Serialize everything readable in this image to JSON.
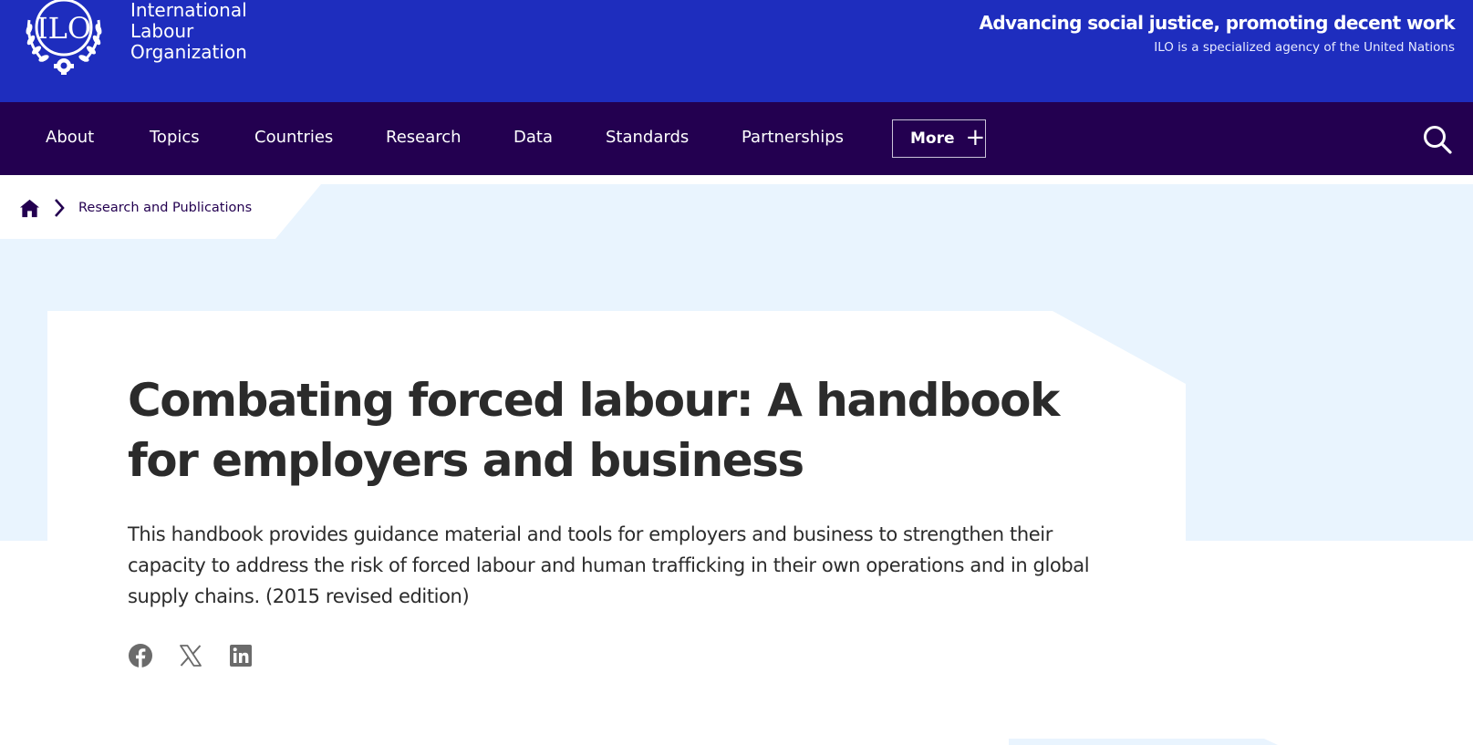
{
  "header": {
    "org_name_lines": [
      "International",
      "Labour",
      "Organization"
    ],
    "logo_text": "ILO",
    "tagline": "Advancing social justice, promoting decent work",
    "subtagline": "ILO is a specialized agency of the United Nations"
  },
  "nav": {
    "items": [
      "About",
      "Topics",
      "Countries",
      "Research",
      "Data",
      "Standards",
      "Partnerships"
    ],
    "more_label": "More",
    "more_icon": "plus-icon",
    "search_icon": "search-icon"
  },
  "breadcrumb": {
    "home_icon": "home-icon",
    "separator_icon": "chevron-right-icon",
    "current": "Research and Publications"
  },
  "article": {
    "title": "Combating forced labour: A handbook for employers and business",
    "description": "This handbook provides guidance material and tools for employers and business to strengthen their capacity to address the risk of forced labour and human trafficking in their own operations and in global supply chains. (2015 revised edition)"
  },
  "social": [
    "facebook-icon",
    "x-icon",
    "linkedin-icon"
  ],
  "colors": {
    "header_blue": "#1e2dbe",
    "nav_purple": "#230050",
    "hero_bg": "#e9f4fe",
    "text": "#2b2b2b",
    "icon_grey": "#6b6b6b"
  }
}
